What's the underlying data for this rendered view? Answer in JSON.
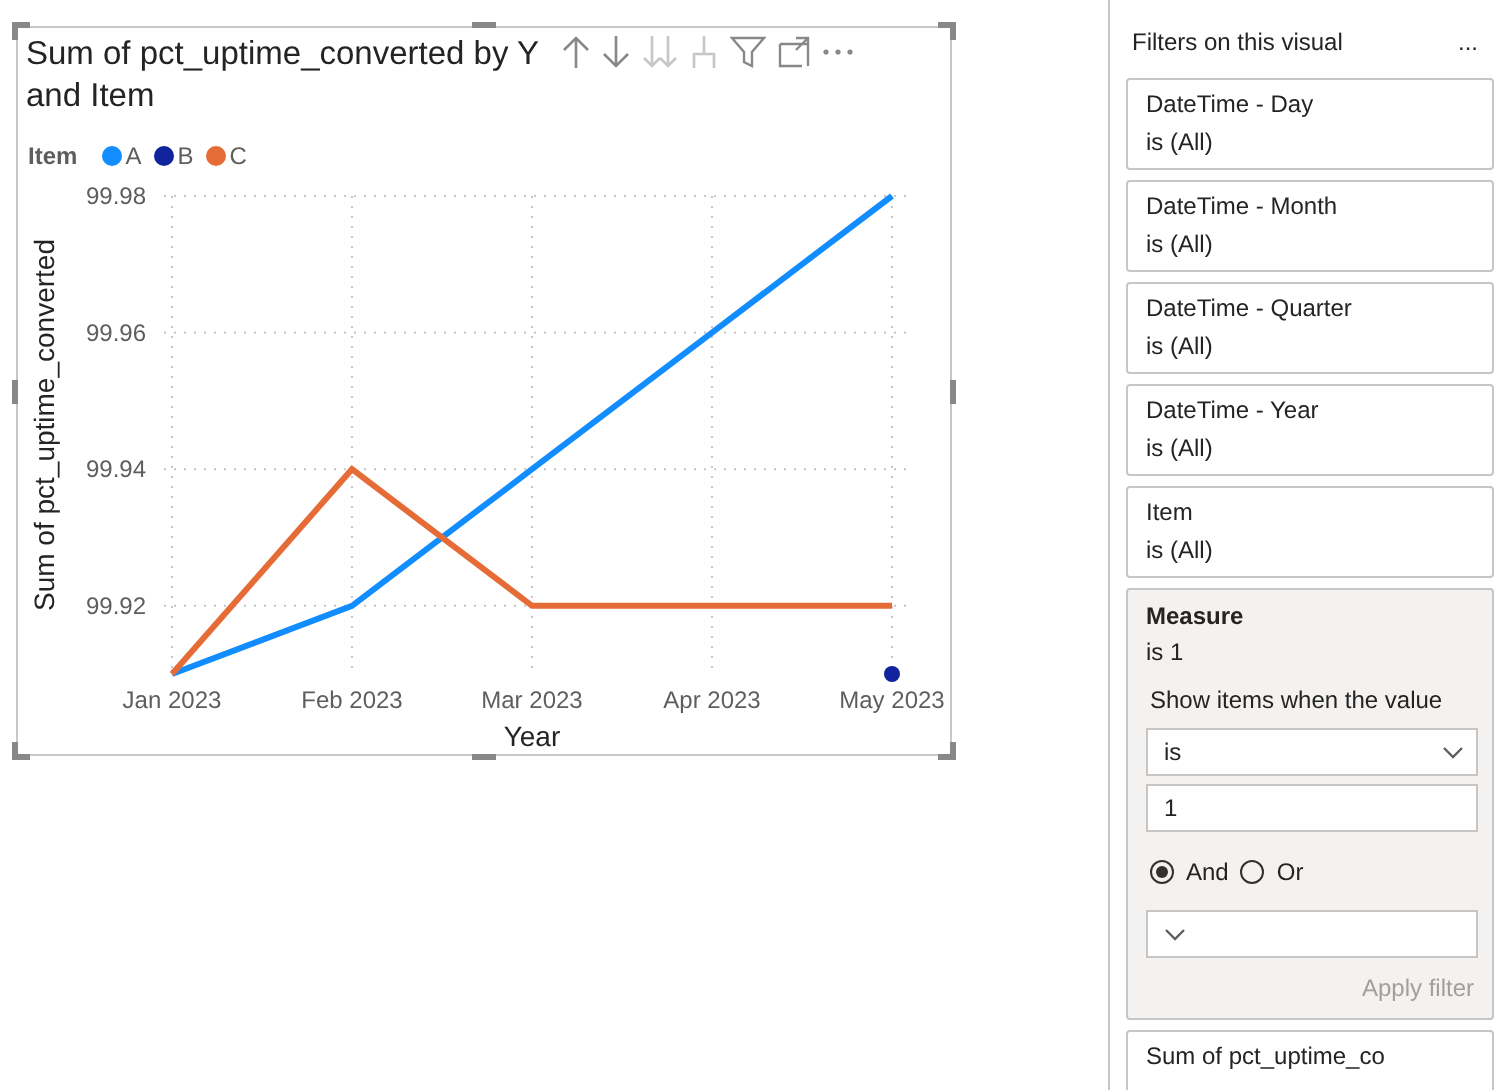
{
  "visual": {
    "title_lines": [
      "Sum of pct_uptime_converted by Y",
      "and Item"
    ],
    "legend": {
      "title": "Item"
    },
    "chart_data": {
      "type": "line",
      "grid": true,
      "xlabel": "Year",
      "ylabel": "Sum of pct_uptime_converted",
      "categories": [
        "Jan 2023",
        "Feb 2023",
        "Mar 2023",
        "Apr 2023",
        "May 2023"
      ],
      "ylim": [
        99.91,
        99.98
      ],
      "yticks": [
        99.92,
        99.94,
        99.96,
        99.98
      ],
      "series": [
        {
          "name": "A",
          "color": "#118dff",
          "marker": false,
          "values": [
            99.91,
            99.92,
            99.94,
            99.96,
            99.98
          ]
        },
        {
          "name": "B",
          "color": "#12239e",
          "marker": true,
          "values": [
            null,
            null,
            null,
            null,
            99.91
          ]
        },
        {
          "name": "C",
          "color": "#e66c37",
          "marker": false,
          "values": [
            99.91,
            99.94,
            99.92,
            99.92,
            99.92
          ]
        }
      ]
    }
  },
  "filter_pane": {
    "title": "Filters on this visual",
    "more": "...",
    "cards": [
      {
        "kind": "summary",
        "name": "DateTime - Day",
        "state": "is (All)"
      },
      {
        "kind": "summary",
        "name": "DateTime - Month",
        "state": "is (All)"
      },
      {
        "kind": "summary",
        "name": "DateTime - Quarter",
        "state": "is (All)"
      },
      {
        "kind": "summary",
        "name": "DateTime - Year",
        "state": "is (All)"
      },
      {
        "kind": "summary",
        "name": "Item",
        "state": "is (All)"
      },
      {
        "kind": "expanded",
        "name": "Measure",
        "state": "is 1",
        "condition_label": "Show items when the value",
        "operator": "is",
        "value": "1",
        "logic": [
          {
            "label": "And",
            "selected": true
          },
          {
            "label": "Or",
            "selected": false
          }
        ],
        "apply": "Apply filter",
        "apply_disabled": true
      },
      {
        "kind": "summary",
        "name": "Sum of pct_uptime_co"
      }
    ]
  }
}
